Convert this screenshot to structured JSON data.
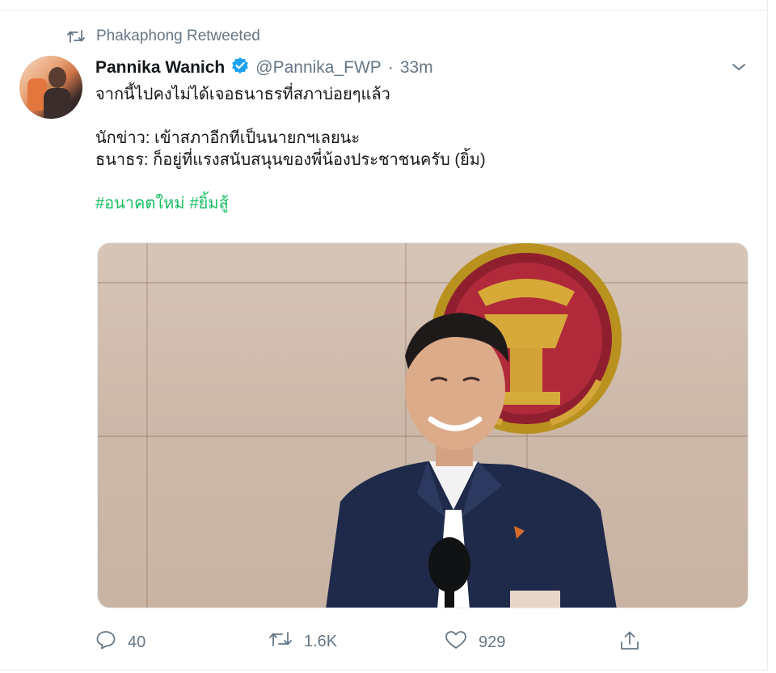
{
  "retweet": {
    "icon": "retweet-icon",
    "text": "Phakaphong Retweeted"
  },
  "tweet": {
    "display_name": "Pannika Wanich",
    "verified_icon": "verified-badge-icon",
    "handle": "@Pannika_FWP",
    "separator": "·",
    "time": "33m",
    "menu_icon": "chevron-down-icon",
    "lines": [
      "จากนี้ไปคงไม่ได้เจอธนาธรที่สภาบ่อยๆแล้ว",
      "นักข่าว: เข้าสภาอีกทีเป็นนายกฯเลยนะ",
      "ธนาธร: ก็อยู่ที่แรงสนับสนุนของพี่น้องประชาชนครับ (ยิ้ม)"
    ],
    "hashtags": [
      "#อนาคตใหม่",
      "#ยิ้มสู้"
    ]
  },
  "actions": {
    "reply": {
      "icon": "reply-icon",
      "count": "40"
    },
    "retweet": {
      "icon": "retweet-icon",
      "count": "1.6K"
    },
    "like": {
      "icon": "heart-icon",
      "count": "929"
    },
    "share": {
      "icon": "share-icon"
    }
  },
  "colors": {
    "muted": "#657786",
    "text": "#14171a",
    "verified": "#1da1f2",
    "hashtag": "#17bf63",
    "border": "#e6ecf0"
  }
}
